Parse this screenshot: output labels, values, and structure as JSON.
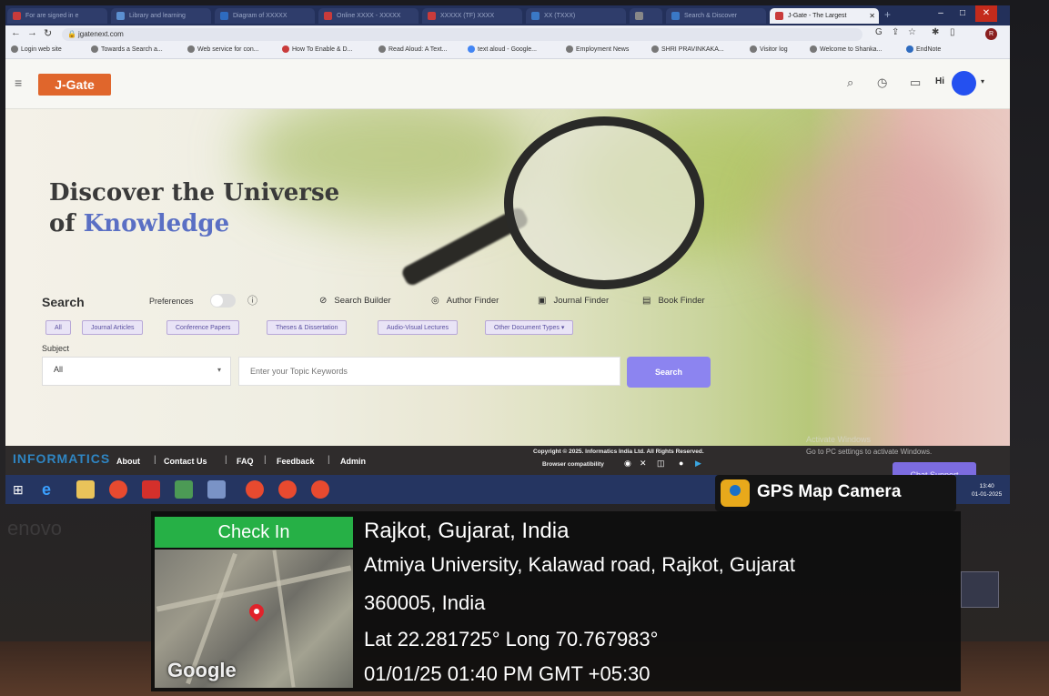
{
  "browser": {
    "tabs": [
      {
        "label": "For are signed in e"
      },
      {
        "label": "Library and learning"
      },
      {
        "label": "Diagram of XXXXX"
      },
      {
        "label": "Online XXXX - XXXXX"
      },
      {
        "label": "XXXXX (TF) XXXX"
      },
      {
        "label": "XX (TXXX)"
      },
      {
        "label": ""
      },
      {
        "label": "Search & Discover"
      },
      {
        "label": "J-Gate - The Largest"
      }
    ],
    "url": "jgatenext.com",
    "profile_initial": "R",
    "bookmarks": [
      "Login web site",
      "Towards a Search a...",
      "Web service for con...",
      "How To Enable & D...",
      "Read Aloud: A Text...",
      "text aloud - Google...",
      "Employment News",
      "SHRI PRAVINKAKA...",
      "Visitor log",
      "Welcome to Shanka...",
      "EndNote"
    ]
  },
  "site": {
    "logo": "J-Gate",
    "greeting": "Hi",
    "hero_line1": "Discover the Universe",
    "hero_line2_prefix": "of ",
    "hero_line2_keyword": "Knowledge",
    "search_label": "Search",
    "preferences_label": "Preferences",
    "finders": [
      "Search Builder",
      "Author Finder",
      "Journal Finder",
      "Book Finder"
    ],
    "doc_types": [
      "All",
      "Journal Articles",
      "Conference Papers",
      "Theses & Dissertation",
      "Audio-Visual Lectures",
      "Other Document Types"
    ],
    "subject_label": "Subject",
    "subject_value": "All",
    "keyword_placeholder": "Enter your Topic Keywords",
    "search_button": "Search"
  },
  "footer": {
    "brand": "INFORMATICS",
    "links": [
      "About",
      "Contact Us",
      "FAQ",
      "Feedback",
      "Admin"
    ],
    "copyright": "Copyright © 2025. Informatics India Ltd. All Rights Reserved.",
    "compat": "Browser compatibility",
    "activate_title": "Activate Windows",
    "activate_sub": "Go to PC settings to activate Windows.",
    "chat_support": "Chat Support"
  },
  "taskbar": {
    "time": "13:40",
    "date": "01-01-2025"
  },
  "bezel_brand": "enovo",
  "gps": {
    "app_name": "GPS Map Camera",
    "checkin_label": "Check In",
    "city": "Rajkot, Gujarat, India",
    "address_line1": "Atmiya University, Kalawad road, Rajkot, Gujarat",
    "address_line2": "360005, India",
    "coords": "Lat 22.281725° Long 70.767983°",
    "timestamp": "01/01/25 01:40 PM GMT +05:30",
    "map_provider": "Google"
  },
  "colors": {
    "logo_orange": "#e0662c",
    "search_button": "#8c84f0",
    "checkin_green": "#26b046",
    "avatar_blue": "#2450f0"
  }
}
